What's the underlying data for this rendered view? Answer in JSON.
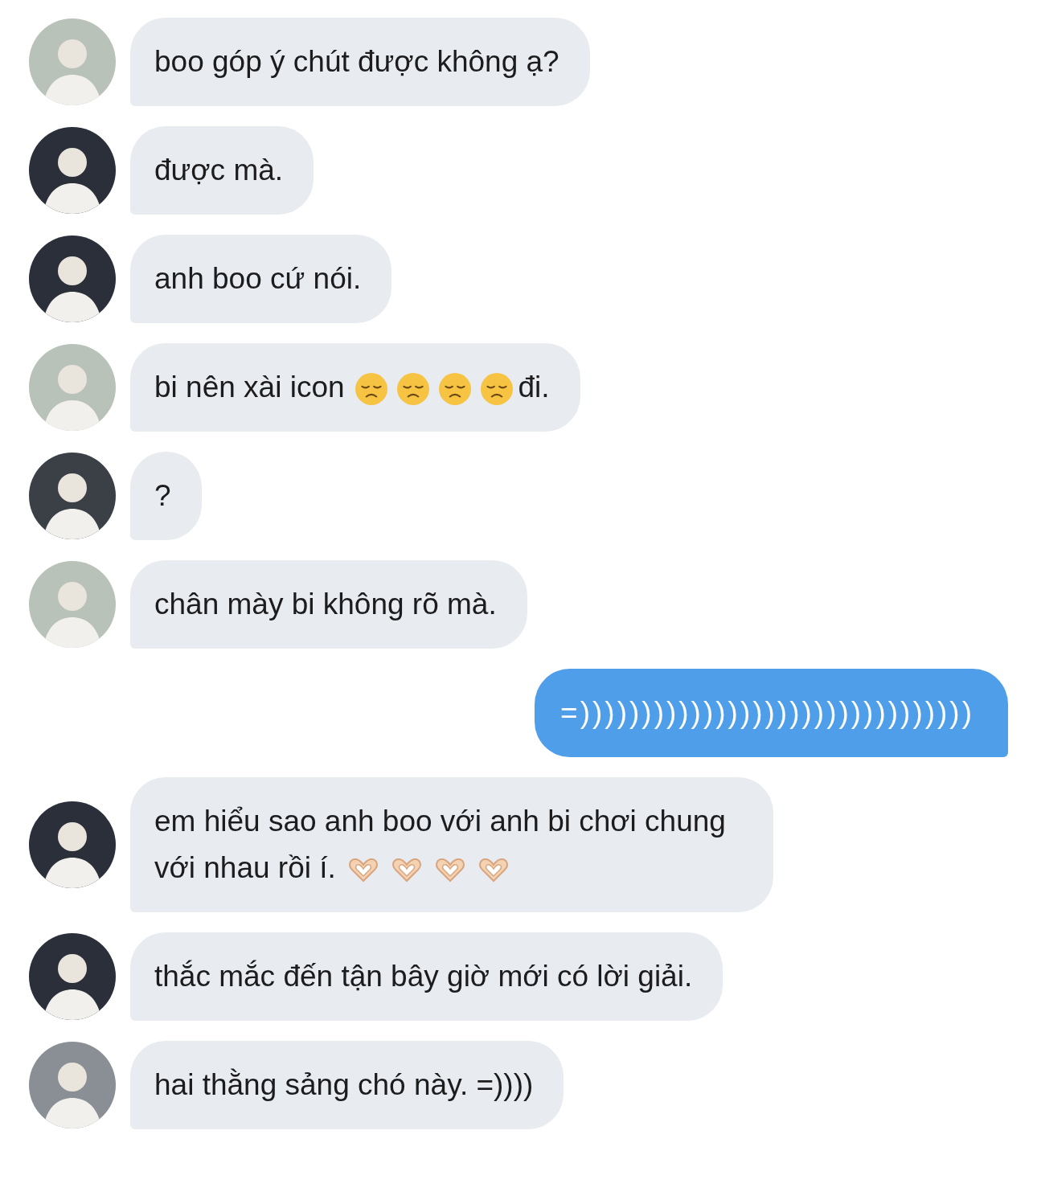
{
  "messages": [
    {
      "outgoing": false,
      "avatar": {
        "color": "#b9c2b8"
      },
      "parts": [
        {
          "kind": "text",
          "text": "boo góp ý chút được không ạ?"
        }
      ]
    },
    {
      "outgoing": false,
      "avatar": {
        "color": "#2a2f3a"
      },
      "parts": [
        {
          "kind": "text",
          "text": "được mà."
        }
      ]
    },
    {
      "outgoing": false,
      "avatar": {
        "color": "#2a2f3a"
      },
      "parts": [
        {
          "kind": "text",
          "text": "anh boo cứ nói."
        }
      ]
    },
    {
      "outgoing": false,
      "avatar": {
        "color": "#b9c2b8"
      },
      "parts": [
        {
          "kind": "text",
          "text": "bi nên xài icon"
        },
        {
          "kind": "sad_emoji"
        },
        {
          "kind": "sad_emoji"
        },
        {
          "kind": "sad_emoji"
        },
        {
          "kind": "sad_emoji"
        },
        {
          "kind": "text",
          "text": "đi."
        }
      ]
    },
    {
      "outgoing": false,
      "avatar": {
        "color": "#3b3f46"
      },
      "parts": [
        {
          "kind": "text",
          "text": "?"
        }
      ]
    },
    {
      "outgoing": false,
      "avatar": {
        "color": "#b9c2b8"
      },
      "parts": [
        {
          "kind": "text",
          "text": "chân mày bi không rõ mà."
        }
      ]
    },
    {
      "outgoing": true,
      "parts": [
        {
          "kind": "text",
          "text": "=))))))))))))))))))))))))))))))))"
        }
      ]
    },
    {
      "outgoing": false,
      "avatar": {
        "color": "#2a2f3a"
      },
      "parts": [
        {
          "kind": "text",
          "text": "em hiểu sao anh boo với anh bi chơi chung với nhau rồi í."
        },
        {
          "kind": "heart_emoji"
        },
        {
          "kind": "heart_emoji"
        },
        {
          "kind": "heart_emoji"
        },
        {
          "kind": "heart_emoji"
        }
      ]
    },
    {
      "outgoing": false,
      "avatar": {
        "color": "#2a2f3a"
      },
      "parts": [
        {
          "kind": "text",
          "text": "thắc mắc đến tận bây giờ mới có lời giải."
        }
      ]
    },
    {
      "outgoing": false,
      "avatar": {
        "color": "#8a8f96"
      },
      "parts": [
        {
          "kind": "text",
          "text": "hai thằng sảng chó này. =))))"
        }
      ]
    }
  ]
}
